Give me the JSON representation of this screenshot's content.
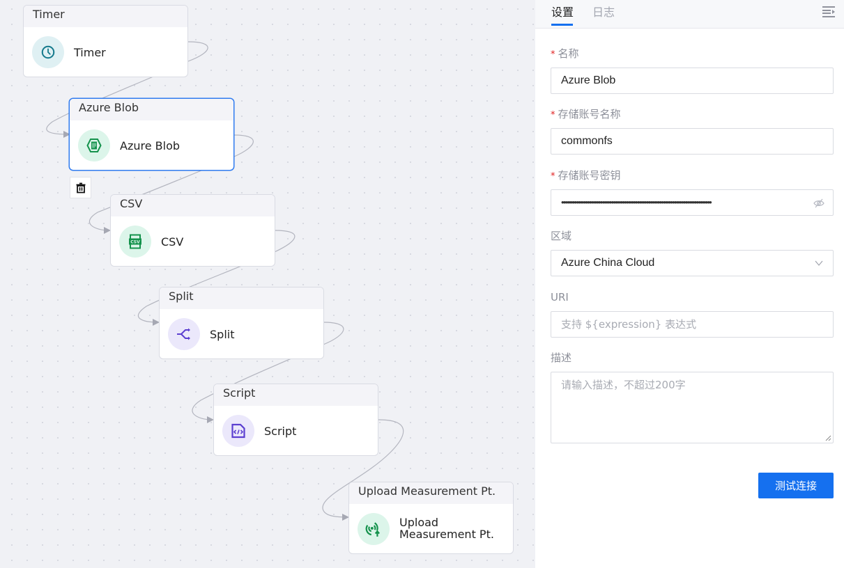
{
  "canvas": {
    "nodes": [
      {
        "id": "timer",
        "header": "Timer",
        "label": "Timer",
        "icon": "clock-icon",
        "icon_color": "#157a8c",
        "selected": false
      },
      {
        "id": "azure-blob",
        "header": "Azure Blob",
        "label": "Azure Blob",
        "icon": "azure-blob-icon",
        "icon_color": "#14924c",
        "selected": true
      },
      {
        "id": "csv",
        "header": "CSV",
        "label": "CSV",
        "icon": "csv-icon",
        "icon_color": "#14924c",
        "selected": false
      },
      {
        "id": "split",
        "header": "Split",
        "label": "Split",
        "icon": "split-icon",
        "icon_color": "#5b3fd0",
        "selected": false
      },
      {
        "id": "script",
        "header": "Script",
        "label": "Script",
        "icon": "script-icon",
        "icon_color": "#5b3fd0",
        "selected": false
      },
      {
        "id": "upload",
        "header": "Upload Measurement Pt.",
        "label": "Upload Measurement Pt.",
        "icon": "upload-signal-icon",
        "icon_color": "#14924c",
        "selected": false
      }
    ],
    "csv_icon_text": "CSV"
  },
  "panel": {
    "tabs": [
      {
        "label": "设置",
        "active": true
      },
      {
        "label": "日志",
        "active": false
      }
    ],
    "fields": {
      "name": {
        "label": "名称",
        "required": true,
        "value": "Azure Blob"
      },
      "account_name": {
        "label": "存储账号名称",
        "required": true,
        "value": "commonfs"
      },
      "account_key": {
        "label": "存储账号密钥",
        "required": true,
        "masked_value": "•••••••••••••••••••••••••••••••••••••••••••••••••••••••••••••••••••••••••••••••••"
      },
      "region": {
        "label": "区域",
        "required": false,
        "value": "Azure China Cloud"
      },
      "uri": {
        "label": "URI",
        "required": false,
        "placeholder": "支持 ${expression} 表达式"
      },
      "description": {
        "label": "描述",
        "required": false,
        "placeholder": "请输入描述，不超过200字"
      }
    },
    "required_mark": "*",
    "test_button": "测试连接",
    "accent_color": "#1570ef"
  }
}
